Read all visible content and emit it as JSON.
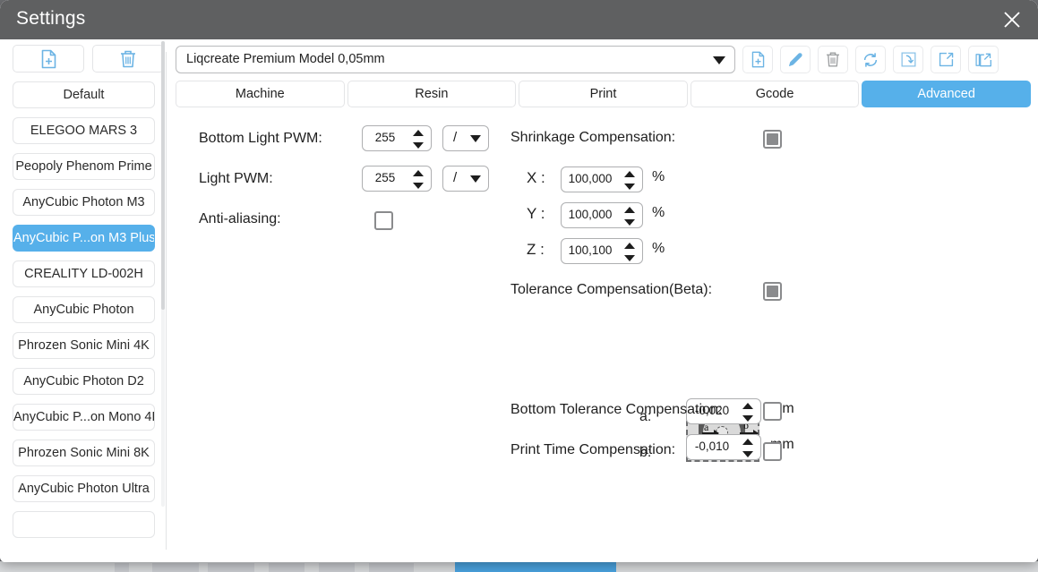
{
  "window": {
    "title": "Settings",
    "close_icon": "close-icon"
  },
  "left_pane": {
    "actions": [
      {
        "name": "new-profile-button",
        "icon": "file-plus-icon"
      },
      {
        "name": "delete-profile-button",
        "icon": "trash-icon"
      }
    ],
    "printers": [
      {
        "label": "Default",
        "selected": false
      },
      {
        "label": "ELEGOO MARS 3",
        "selected": false
      },
      {
        "label": "Peopoly Phenom Prime",
        "selected": false
      },
      {
        "label": "AnyCubic Photon M3",
        "selected": false
      },
      {
        "label": "AnyCubic P...on M3 Plus",
        "selected": true
      },
      {
        "label": "CREALITY LD-002H",
        "selected": false
      },
      {
        "label": "AnyCubic Photon",
        "selected": false
      },
      {
        "label": "Phrozen Sonic Mini 4K",
        "selected": false
      },
      {
        "label": "AnyCubic Photon D2",
        "selected": false
      },
      {
        "label": "AnyCubic P...on Mono 4K",
        "selected": false
      },
      {
        "label": "Phrozen Sonic Mini 8K",
        "selected": false
      },
      {
        "label": "AnyCubic Photon Ultra",
        "selected": false
      },
      {
        "label": "",
        "selected": false
      }
    ]
  },
  "profile_bar": {
    "selected_profile": "Liqcreate Premium Model 0,05mm",
    "tools": [
      {
        "name": "new-resin-profile-button",
        "icon": "file-plus-icon"
      },
      {
        "name": "edit-profile-button",
        "icon": "pencil-icon"
      },
      {
        "name": "delete-resin-profile-button",
        "icon": "trash-icon"
      },
      {
        "name": "reset-profile-button",
        "icon": "refresh-icon"
      },
      {
        "name": "import-profile-button",
        "icon": "import-arrow-icon"
      },
      {
        "name": "export-profile-button",
        "icon": "export-arrow-icon"
      },
      {
        "name": "export-all-profiles-button",
        "icon": "export-all-icon"
      }
    ]
  },
  "tabs": [
    {
      "label": "Machine",
      "active": false
    },
    {
      "label": "Resin",
      "active": false
    },
    {
      "label": "Print",
      "active": false
    },
    {
      "label": "Gcode",
      "active": false
    },
    {
      "label": "Advanced",
      "active": true
    }
  ],
  "advanced": {
    "bottom_light_pwm": {
      "label": "Bottom Light PWM:",
      "value": "255",
      "mode": "/"
    },
    "light_pwm": {
      "label": "Light PWM:",
      "value": "255",
      "mode": "/"
    },
    "anti_aliasing": {
      "label": "Anti-aliasing:",
      "checked": false
    },
    "shrinkage_compensation": {
      "label": "Shrinkage Compensation:",
      "enabled": true,
      "axes": [
        {
          "axis": "X :",
          "value": "100,000",
          "unit": "%"
        },
        {
          "axis": "Y :",
          "value": "100,000",
          "unit": "%"
        },
        {
          "axis": "Z :",
          "value": "100,100",
          "unit": "%"
        }
      ]
    },
    "tolerance_compensation": {
      "label": "Tolerance Compensation(Beta):",
      "enabled": true,
      "diagram": {
        "label_a": "a",
        "label_b": "b"
      },
      "fields": [
        {
          "label": "a:",
          "value": "-0,020",
          "unit": "mm"
        },
        {
          "label": "b:",
          "value": "-0,010",
          "unit": "mm"
        }
      ]
    },
    "bottom_tolerance_compensation": {
      "label": "Bottom Tolerance Compensation:",
      "checked": false
    },
    "print_time_compensation": {
      "label": "Print Time Compensation:",
      "checked": false
    }
  },
  "colors": {
    "accent": "#56b0ea",
    "title_bar": "#5f6061",
    "icon_blue": "#6cb4e4"
  }
}
